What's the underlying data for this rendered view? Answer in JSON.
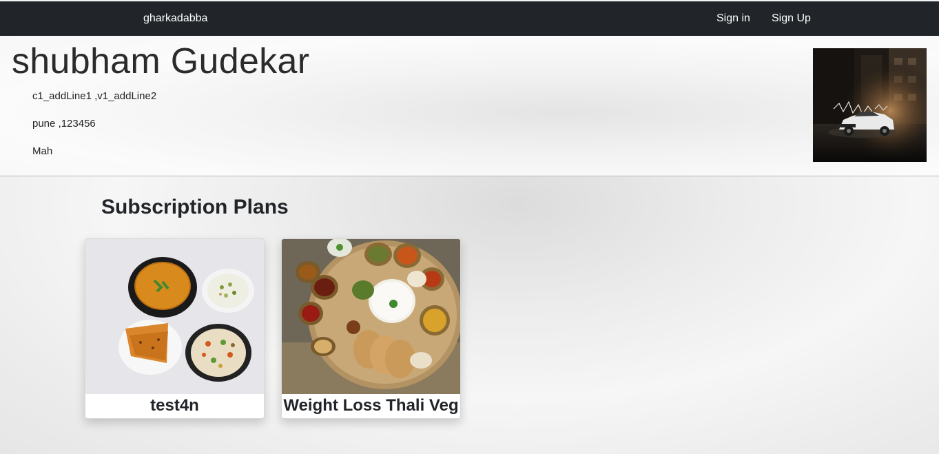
{
  "navbar": {
    "brand": "gharkadabba",
    "links": [
      {
        "label": "Sign in"
      },
      {
        "label": "Sign Up"
      }
    ],
    "background": "#212529"
  },
  "profile": {
    "name": "shubham Gudekar",
    "address_line": "c1_addLine1 ,v1_addLine2",
    "city_pin": "pune ,123456",
    "state": "Mah",
    "avatar": "car-photo"
  },
  "plans": {
    "heading": "Subscription Plans",
    "items": [
      {
        "title": "test4n",
        "image": "dal-rice-paratha-photo"
      },
      {
        "title": "Weight Loss Thali Veg",
        "image": "veg-thali-photo"
      }
    ]
  }
}
